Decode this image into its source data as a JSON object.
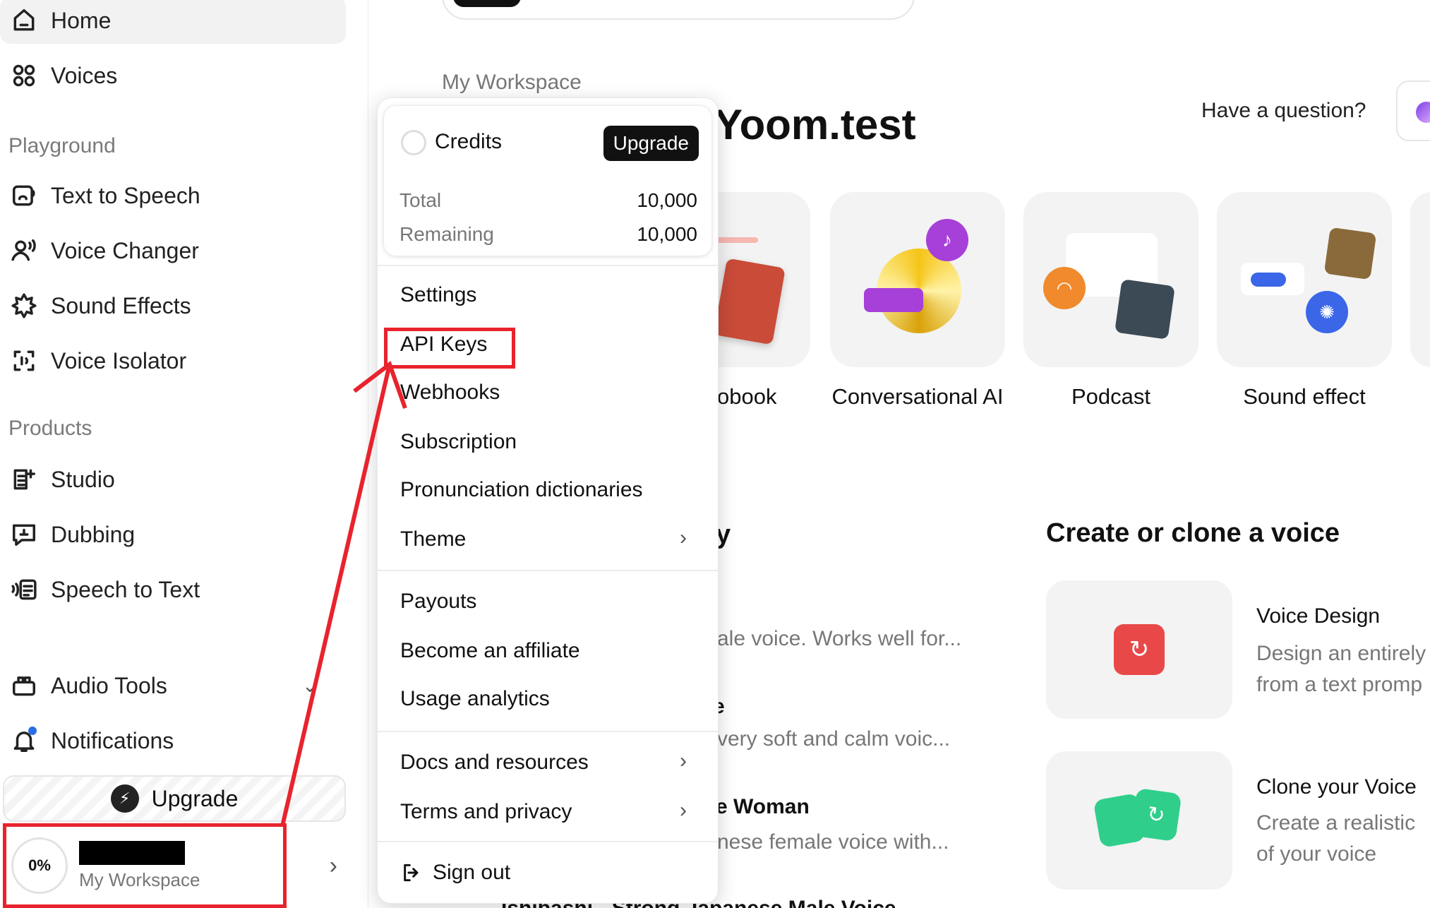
{
  "sidebar": {
    "nav_top": [
      {
        "label": "Home",
        "icon": "home-icon",
        "active": true
      },
      {
        "label": "Voices",
        "icon": "voices-grid-icon"
      }
    ],
    "playground_title": "Playground",
    "playground": [
      {
        "label": "Text to Speech",
        "icon": "text-to-speech-icon"
      },
      {
        "label": "Voice Changer",
        "icon": "voice-changer-icon"
      },
      {
        "label": "Sound Effects",
        "icon": "sound-effects-icon"
      },
      {
        "label": "Voice Isolator",
        "icon": "voice-isolator-icon"
      }
    ],
    "products_title": "Products",
    "products": [
      {
        "label": "Studio",
        "icon": "studio-icon"
      },
      {
        "label": "Dubbing",
        "icon": "dubbing-icon"
      },
      {
        "label": "Speech to Text",
        "icon": "speech-to-text-icon"
      }
    ],
    "audio_tools": "Audio Tools",
    "notifications": "Notifications",
    "upgrade": "Upgrade",
    "account": {
      "percent": "0%",
      "workspace": "My Workspace"
    }
  },
  "main": {
    "workspace_label": "My Workspace",
    "greeting": "Yoom.test",
    "have_question": "Have a question?",
    "cards": [
      {
        "label": "obook"
      },
      {
        "label": "Conversational AI"
      },
      {
        "label": "Podcast"
      },
      {
        "label": "Sound effect"
      }
    ],
    "library_heading_tail": "y",
    "voices": [
      {
        "desc": "ale voice. Works well for..."
      },
      {
        "name": "e",
        "desc": "very soft and calm voic..."
      },
      {
        "name": "e Woman",
        "desc": "nese female voice with..."
      },
      {
        "name": "Ishibashi - Strong Japanese Male Voice"
      }
    ],
    "create_heading": "Create or clone a voice",
    "voice_design": {
      "title": "Voice Design",
      "desc1": "Design an entirely",
      "desc2": "from a text promp"
    },
    "clone_voice": {
      "title": "Clone your Voice",
      "desc1": "Create a realistic",
      "desc2": "of your voice"
    }
  },
  "menu": {
    "credits_title": "Credits",
    "upgrade": "Upgrade",
    "total_label": "Total",
    "total_value": "10,000",
    "remaining_label": "Remaining",
    "remaining_value": "10,000",
    "items_1": [
      "Settings",
      "API Keys",
      "Webhooks",
      "Subscription",
      "Pronunciation dictionaries",
      "Theme"
    ],
    "items_2": [
      "Payouts",
      "Become an affiliate",
      "Usage analytics"
    ],
    "items_3": [
      "Docs and resources",
      "Terms and privacy"
    ],
    "sign_out": "Sign out"
  },
  "colors": {
    "annotation_red": "#e8232d",
    "voice_design_red": "#e94848",
    "clone_green": "#2fcf8b",
    "conversational_purple": "#a640d8",
    "podcast_orange": "#f08a2c",
    "sound_blue": "#3b66e8"
  }
}
